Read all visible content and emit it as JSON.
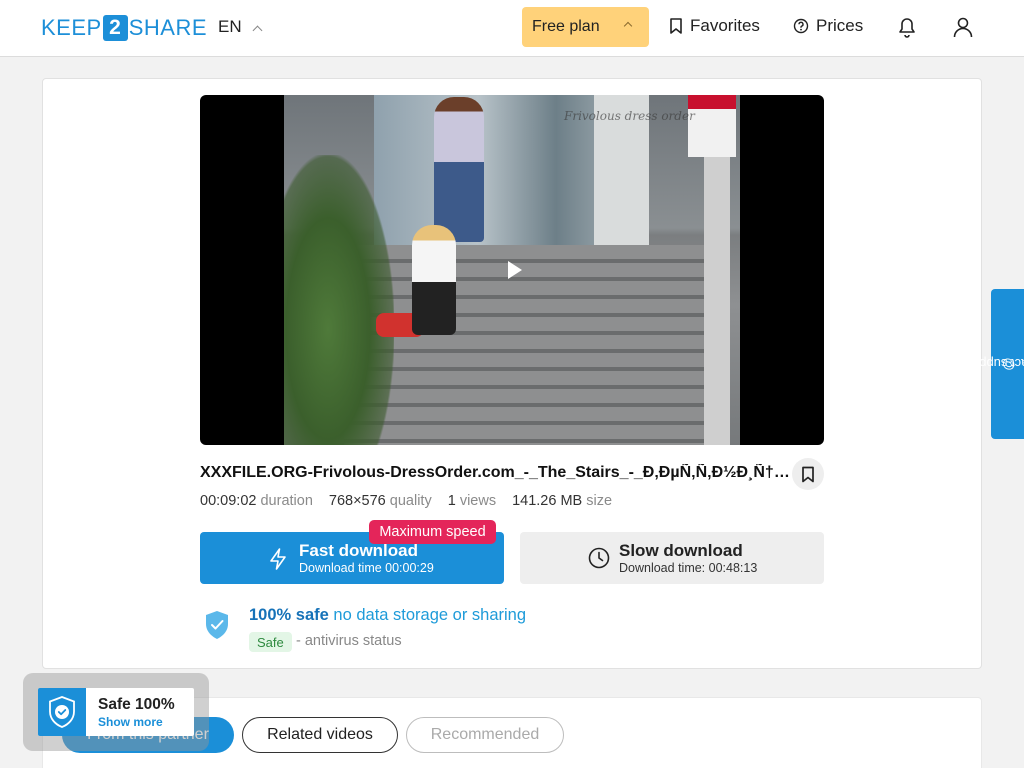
{
  "header": {
    "logo_left": "KEEP",
    "logo_mid": "2",
    "logo_right": "SHARE",
    "language": "EN",
    "plan": "Free plan",
    "favorites": "Favorites",
    "prices": "Prices"
  },
  "video": {
    "watermark": "Frivolous dress order"
  },
  "file": {
    "name": "XXXFILE.ORG-Frivolous-DressOrder.com_-_The_Stairs_-_Ð‚ÐµÑ‚Ñ‚Ð½Ð¸Ñ†Ð°",
    "duration_value": "00:09:02",
    "duration_label": "duration",
    "quality_value": "768×576",
    "quality_label": "quality",
    "views_value": "1",
    "views_label": "views",
    "size_value": "141.26 MB",
    "size_label": "size"
  },
  "download": {
    "max_speed": "Maximum speed",
    "fast_title": "Fast download",
    "fast_sub": "Download time 00:00:29",
    "slow_title": "Slow download",
    "slow_sub": "Download time: 00:48:13"
  },
  "safety": {
    "bold": "100% safe",
    "rest": "no data storage or sharing",
    "badge": "Safe",
    "status": "- antivirus status"
  },
  "support": "contact support",
  "tabs": {
    "partner": "From this partner",
    "related": "Related videos",
    "recommended": "Recommended"
  },
  "popup": {
    "title": "Safe 100%",
    "link": "Show more"
  },
  "colors": {
    "primary": "#1b8fd8",
    "plan_bg": "#ffd27a",
    "max_speed": "#e4255a"
  }
}
